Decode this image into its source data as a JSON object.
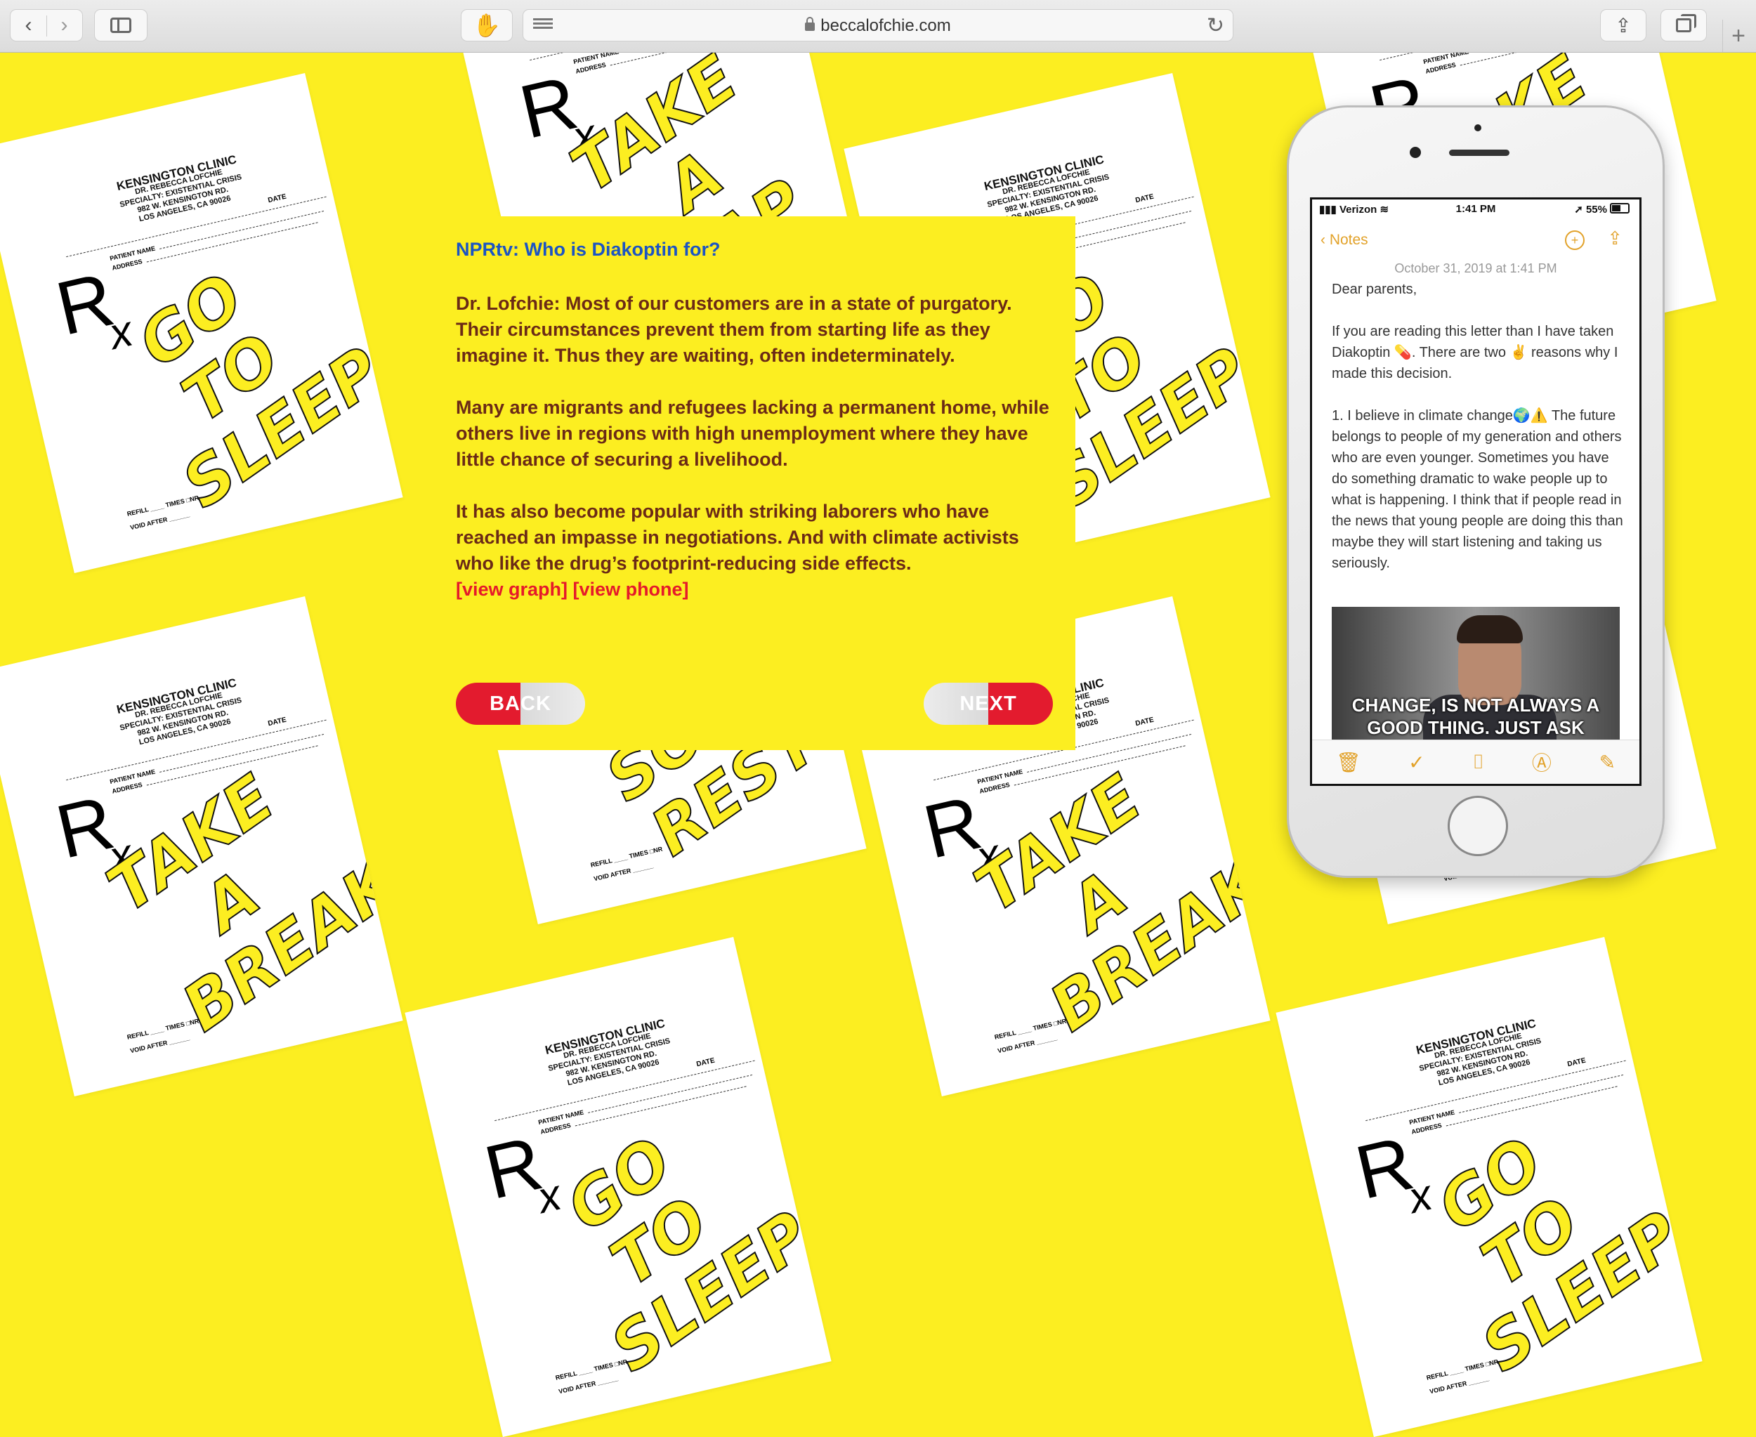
{
  "browser": {
    "url": "beccalofchie.com",
    "back_icon": "chevron-left-icon",
    "forward_icon": "chevron-right-icon"
  },
  "rx_paper": {
    "clinic": "KENSINGTON CLINIC",
    "doctor": "DR. REBECCA LOFCHIE",
    "specialty": "SPECIALTY: EXISTENTIAL CRISIS",
    "street": "982 W. KENSINGTON RD.",
    "city": "LOS ANGELES, CA 90026",
    "date_label": "DATE",
    "patient_label": "PATIENT NAME",
    "address_label": "ADDRESS",
    "refill_label": "REFILL ____ TIMES □NR",
    "void_label": "VOID AFTER ______",
    "rx_symbol": "R",
    "rx_sub": "x",
    "phrases": [
      "GO TO SLEEP",
      "TAKE A BREAK",
      "GET SOME REST",
      "TAKE A NAP"
    ]
  },
  "card": {
    "question": "NPRtv: Who is Diakoptin for?",
    "p1": "Dr. Lofchie: Most of our customers are in a state of purgatory. Their circumstances prevent them from starting life as they imagine it. Thus they are waiting, often indeterminately.",
    "p2": "Many are migrants and refugees lacking a permanent home, while others live in regions with high unemployment where they have little chance of securing a livelihood.",
    "p3": "It has also become popular with striking laborers who have reached an impasse in negotiations. And with climate activists who like the drug’s footprint-reducing side effects.",
    "link_graph": "[view graph]",
    "link_phone": "[view phone]",
    "back_label": "BACK",
    "next_label": "NEXT"
  },
  "phone": {
    "carrier": "Verizon",
    "time": "1:41 PM",
    "battery": "55%",
    "back_label": "Notes",
    "note_date": "October 31, 2019 at 1:41 PM",
    "greeting": "Dear parents,",
    "para1": "If you are reading this letter than I have taken Diakoptin 💊. There are two ✌ reasons why I made this decision.",
    "para2": "1. I believe in climate change🌍⚠️ The future belongs to people of my generation and others who are even younger. Sometimes you have do something dramatic to wake people up to what is happening. I think that if people read in the news that young people are doing this than maybe they will start listening and taking us seriously.",
    "gif_caption": "CHANGE, IS NOT ALWAYS A GOOD THING. JUST ASK",
    "toolbar_icons": [
      "trash-icon",
      "checklist-icon",
      "camera-icon",
      "markup-icon",
      "compose-icon"
    ]
  }
}
